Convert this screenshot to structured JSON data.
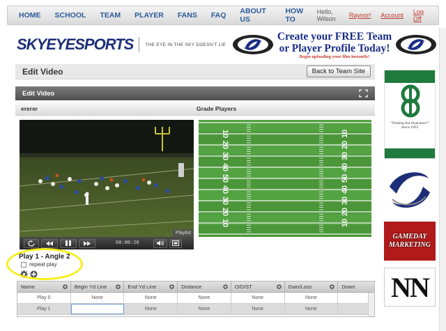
{
  "nav": {
    "items": [
      "HOME",
      "SCHOOL",
      "TEAM",
      "PLAYER",
      "FANS",
      "FAQ",
      "ABOUT US",
      "HOW TO"
    ],
    "greeting": "Hello, Wilson",
    "user": "Raynor!",
    "account": "Account",
    "logoff": "Log Off"
  },
  "brand": {
    "logo": "SKYEYESPORTS",
    "tagline": "THE EYE IN THE SKY DOESN'T LIE"
  },
  "ad": {
    "line1": "Create your FREE Team",
    "line2": "or Player Profile Today!",
    "line3": "Begin uploading your film instantly!"
  },
  "page": {
    "title": "Edit Video",
    "back_button": "Back to Team Site",
    "panel_title": "Edit Video",
    "video_name": "ererer",
    "grade_title": "Grade Players"
  },
  "player": {
    "playlist": "Playlist",
    "time": "00:00:20"
  },
  "field": {
    "yard_numbers": [
      "10",
      "20",
      "30",
      "40",
      "50",
      "40",
      "30",
      "20",
      "10"
    ]
  },
  "play": {
    "label": "Play 1 - Angle 2",
    "repeat_label": "repeat play",
    "repeat_checked": false
  },
  "grid": {
    "columns": [
      "Name",
      "Begin Yd Line",
      "End Yd Line",
      "Distance",
      "O/D/ST",
      "Gain/Loss",
      "Down"
    ],
    "rows": [
      [
        "Play 0",
        "None",
        "None",
        "None",
        "None",
        "None",
        ""
      ],
      [
        "Play 1",
        "",
        "None",
        "None",
        "None",
        "None",
        ""
      ]
    ]
  },
  "side_ads": {
    "ad1_quote": "\"Nothing but Insurance!\"",
    "ad1_since": "Since 1953",
    "ad2_text": "GAMEDAY MARKETING",
    "ad3_text": "NN"
  },
  "colors": {
    "nav_link": "#2a5a9a",
    "brand_blue": "#1d2e78",
    "field_green": "#4c9b3b",
    "highlight": "#f5ef18",
    "gameday_red": "#b11a1a",
    "insurance_green": "#1f7a3e"
  }
}
